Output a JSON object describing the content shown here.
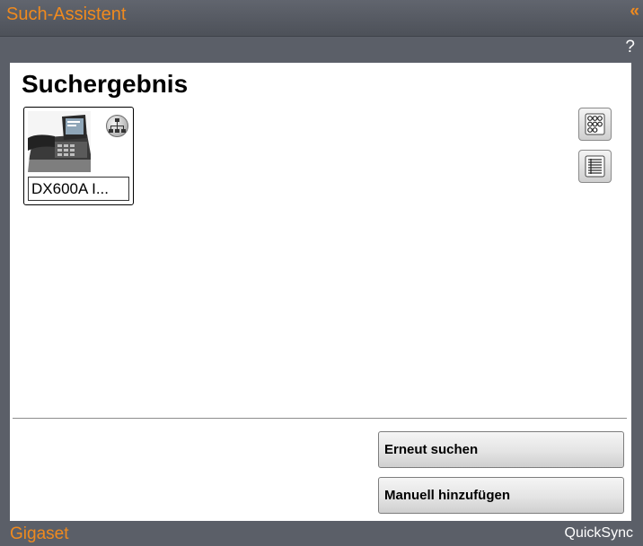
{
  "window": {
    "title": "Such-Assistent",
    "collapse_symbol": "«",
    "help_symbol": "?"
  },
  "main": {
    "heading": "Suchergebnis",
    "devices": [
      {
        "label": "DX600A I...",
        "connection_icon": "network-icon",
        "image": "desk-phone-image"
      }
    ],
    "view_buttons": [
      {
        "icon": "grid-view-icon"
      },
      {
        "icon": "list-view-icon"
      }
    ],
    "actions": {
      "search_again": "Erneut suchen",
      "add_manually": "Manuell hinzufügen"
    }
  },
  "footer": {
    "brand": "Gigaset",
    "product": "QuickSync"
  },
  "colors": {
    "accent": "#f08a1e",
    "chrome": "#5b5f68",
    "panel": "#ffffff"
  }
}
